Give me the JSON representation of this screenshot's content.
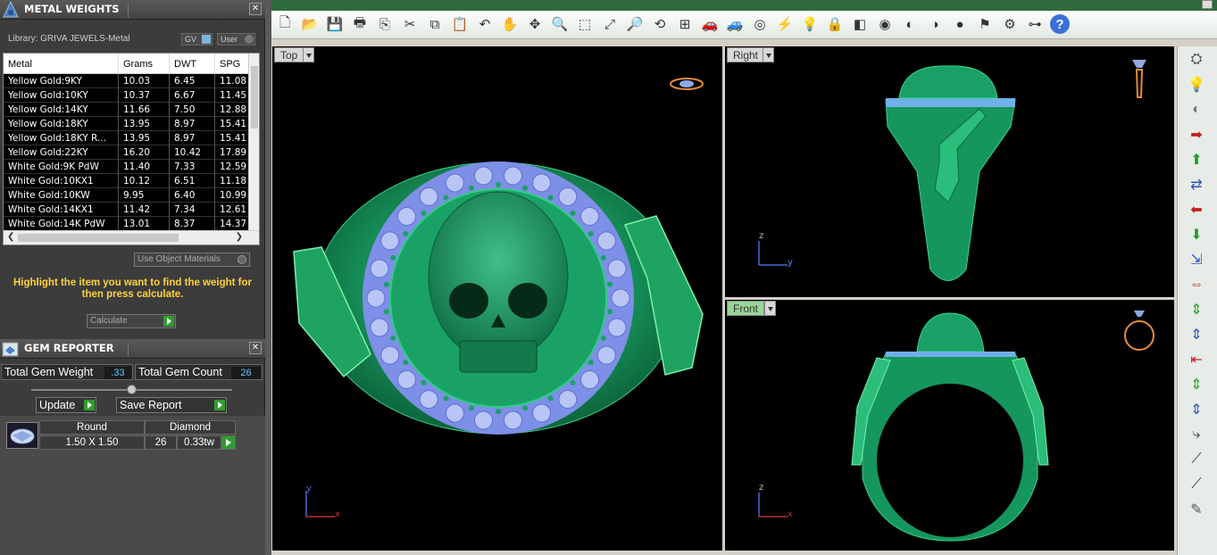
{
  "metal_panel": {
    "title": "METAL WEIGHTS",
    "library_label": "Library: GRIVA JEWELS-Metal",
    "toggle_gv": "GV",
    "toggle_user": "User",
    "columns": [
      "Metal",
      "Grams",
      "DWT",
      "SPG"
    ],
    "rows": [
      [
        "Yellow Gold:9KY",
        "10.03",
        "6.45",
        "11.08"
      ],
      [
        "Yellow Gold:10KY",
        "10.37",
        "6.67",
        "11.45"
      ],
      [
        "Yellow Gold:14KY",
        "11.66",
        "7.50",
        "12.88"
      ],
      [
        "Yellow Gold:18KY",
        "13.95",
        "8.97",
        "15.41"
      ],
      [
        "Yellow Gold:18KY R...",
        "13.95",
        "8.97",
        "15.41"
      ],
      [
        "Yellow Gold:22KY",
        "16.20",
        "10.42",
        "17.89"
      ],
      [
        "White Gold:9K PdW",
        "11.40",
        "7.33",
        "12.59"
      ],
      [
        "White Gold:10KX1",
        "10.12",
        "6.51",
        "11.18"
      ],
      [
        "White Gold:10KW",
        "9.95",
        "6.40",
        "10.99"
      ],
      [
        "White Gold:14KX1",
        "11.42",
        "7.34",
        "12.61"
      ],
      [
        "White Gold:14K PdW",
        "13.01",
        "8.37",
        "14.37"
      ]
    ],
    "use_object_materials": "Use Object Materials",
    "hint": "Highlight the item you want to find the weight for then press calculate.",
    "calculate_label": "Calculate"
  },
  "gem_panel": {
    "title": "GEM REPORTER",
    "total_weight_label": "Total Gem Weight",
    "total_weight_value": ".33",
    "total_count_label": "Total Gem Count",
    "total_count_value": "26",
    "update_label": "Update",
    "save_report_label": "Save Report",
    "gem": {
      "shape": "Round",
      "type": "Diamond",
      "size": "1.50 X 1.50",
      "count": "26",
      "weight": "0.33tw"
    }
  },
  "viewports": {
    "top": "Top",
    "right": "Right",
    "front": "Front"
  },
  "axes": {
    "top": [
      "y",
      "x"
    ],
    "right": [
      "z",
      "y"
    ],
    "front": [
      "z",
      "x"
    ]
  },
  "toolbar_icons": [
    "new-icon",
    "open-icon",
    "save-icon",
    "print-icon",
    "export-icon",
    "cut-icon",
    "copy-icon",
    "paste-icon",
    "undo-icon",
    "pan-icon",
    "rotate-view-icon",
    "zoom-icon",
    "zoom-window-icon",
    "zoom-extents-icon",
    "zoom-selected-icon",
    "rotate-icon",
    "four-view-icon",
    "car-icon",
    "car2-icon",
    "circle-icon",
    "snap-icon",
    "bulb-icon",
    "lock-icon",
    "layers-icon",
    "color-wheel-icon",
    "shade-icon",
    "render-icon",
    "sphere-icon",
    "flag-icon",
    "settings-icon",
    "measure-icon",
    "help-icon"
  ],
  "right_icons": [
    "gems-icon",
    "light-icon",
    "material-sphere-icon",
    "move-right-icon",
    "move-up-icon",
    "move-blue-icon",
    "move-left-icon",
    "move-down-icon",
    "move-diag-icon",
    "move-both-icon",
    "move-vert-icon",
    "move-vert2-icon",
    "shrink-icon",
    "move-vert3-icon",
    "move-vert4-icon",
    "curve-icon",
    "line-icon",
    "line2-icon",
    "eraser-icon"
  ]
}
